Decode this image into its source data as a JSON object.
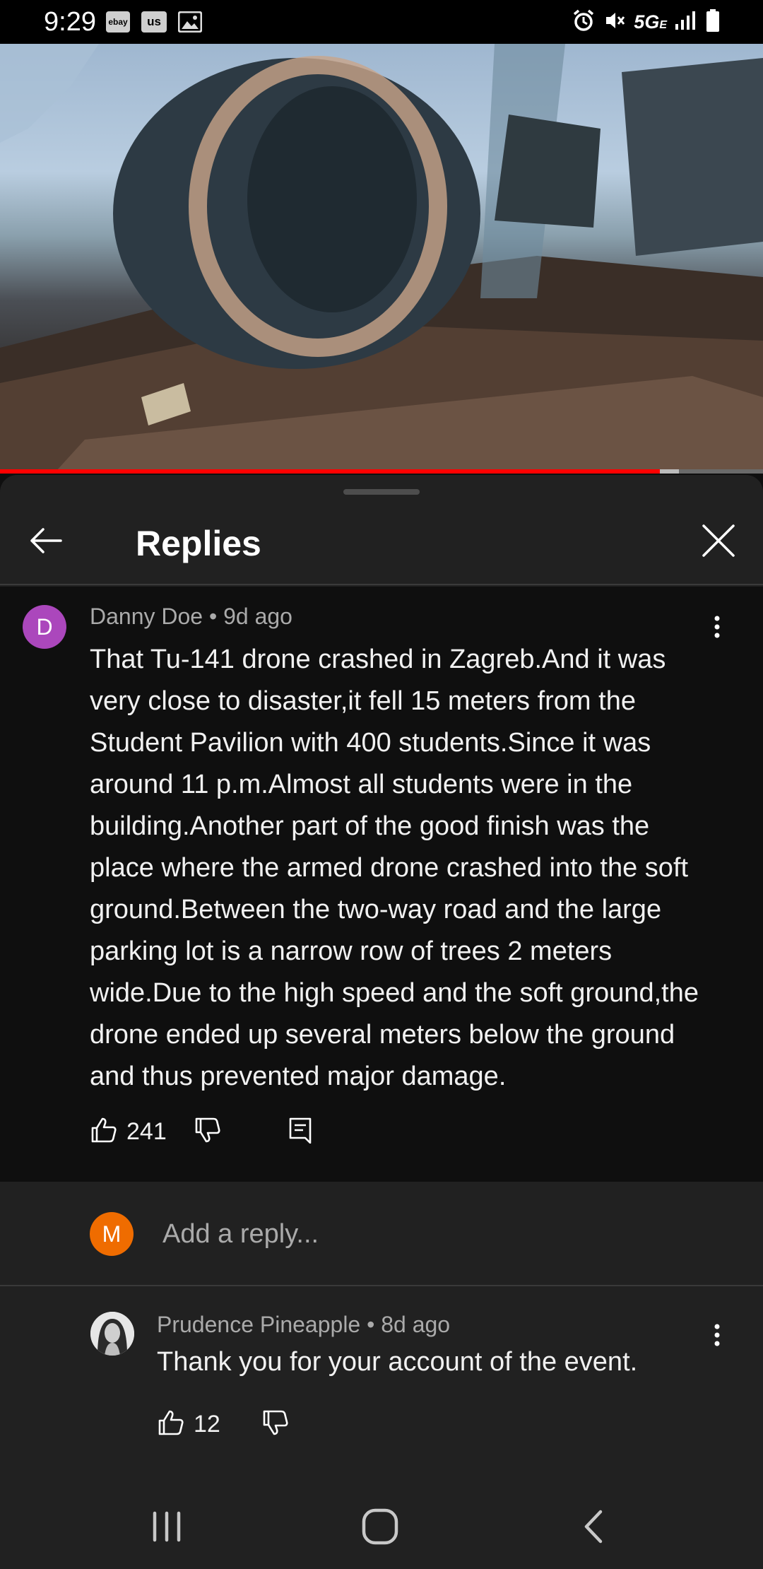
{
  "status_bar": {
    "time": "9:29",
    "notification_badges": [
      "ebay",
      "us"
    ],
    "network": "5G",
    "network_sub": "E",
    "icons": [
      "image-icon",
      "alarm-icon",
      "mute-icon",
      "signal-icon",
      "battery-icon"
    ]
  },
  "video": {
    "progress_fraction": 0.865,
    "buffer_fraction": 0.89
  },
  "sheet": {
    "title": "Replies",
    "back_icon": "arrow-back-icon",
    "close_icon": "close-icon"
  },
  "parent_comment": {
    "avatar_letter": "D",
    "avatar_color": "#ab47bc",
    "author": "Danny Doe",
    "time": "9d ago",
    "text": "That Tu-141 drone crashed in Zagreb.And it was very close to disaster,it fell 15 meters from the Student Pavilion with 400 students.Since it was around 11 p.m.Almost all students were in the building.Another part of the good finish was the place where the armed drone crashed into the soft ground.Between the two-way road and the large parking lot is a narrow row of trees 2 meters wide.Due to the high speed and the soft ground,the drone ended up several meters below the ground and thus prevented major damage.",
    "likes": "241"
  },
  "add_reply": {
    "avatar_letter": "M",
    "avatar_color": "#ef6c00",
    "placeholder": "Add a reply..."
  },
  "reply": {
    "author": "Prudence Pineapple",
    "time": "8d ago",
    "text": "Thank you for your account of the event.",
    "likes": "12"
  },
  "nav_bar": {
    "icons": [
      "recents-icon",
      "home-icon",
      "back-icon"
    ]
  },
  "colors": {
    "background": "#0f0f0f",
    "sheet": "#212121",
    "progress": "#ff0000",
    "secondary_text": "#aaaaaa"
  }
}
